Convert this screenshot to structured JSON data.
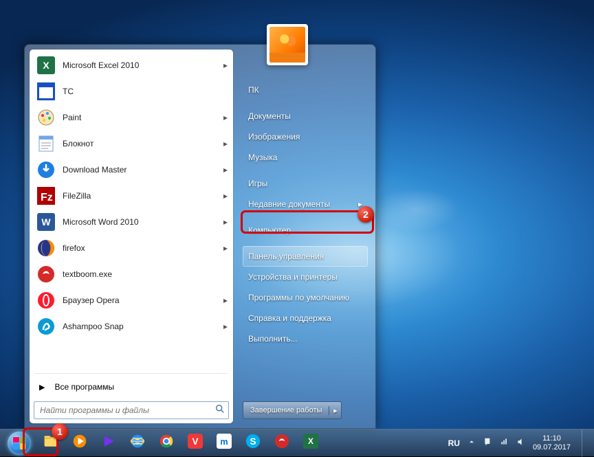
{
  "programs": [
    {
      "label": "Microsoft Excel 2010",
      "icon": "excel",
      "arrow": true
    },
    {
      "label": "TC",
      "icon": "tc",
      "arrow": false
    },
    {
      "label": "Paint",
      "icon": "paint",
      "arrow": true
    },
    {
      "label": "Блокнот",
      "icon": "notepad",
      "arrow": true
    },
    {
      "label": "Download Master",
      "icon": "dm",
      "arrow": true
    },
    {
      "label": "FileZilla",
      "icon": "filezilla",
      "arrow": true
    },
    {
      "label": "Microsoft Word 2010",
      "icon": "word",
      "arrow": true
    },
    {
      "label": "firefox",
      "icon": "firefox",
      "arrow": true
    },
    {
      "label": "textboom.exe",
      "icon": "textboom",
      "arrow": false
    },
    {
      "label": "Браузер Opera",
      "icon": "opera",
      "arrow": true
    },
    {
      "label": "Ashampoo Snap",
      "icon": "ashampoo",
      "arrow": true
    }
  ],
  "all_programs": "Все программы",
  "search_placeholder": "Найти программы и файлы",
  "right_items": [
    {
      "label": "ПК",
      "gap_after": true
    },
    {
      "label": "Документы"
    },
    {
      "label": "Изображения"
    },
    {
      "label": "Музыка",
      "gap_after": true
    },
    {
      "label": "Игры"
    },
    {
      "label": "Недавние документы",
      "arrow": true,
      "gap_after": true
    },
    {
      "label": "Компьютер",
      "gap_after": true
    },
    {
      "label": "Панель управления",
      "highlight": true
    },
    {
      "label": "Устройства и принтеры"
    },
    {
      "label": "Программы по умолчанию"
    },
    {
      "label": "Справка и поддержка"
    },
    {
      "label": "Выполнить..."
    }
  ],
  "shutdown_label": "Завершение работы",
  "taskbar_apps": [
    "explorer",
    "wmp",
    "player",
    "ie",
    "chrome",
    "vivaldi",
    "maxthon",
    "skype",
    "ashampoo",
    "excel"
  ],
  "tray": {
    "lang": "RU",
    "time": "11:10",
    "date": "09.07.2017"
  },
  "callout_badges": {
    "start": "1",
    "control_panel": "2"
  }
}
